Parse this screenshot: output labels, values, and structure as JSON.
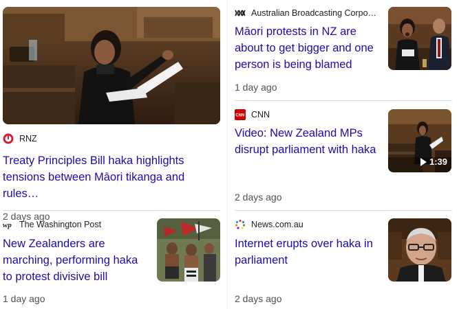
{
  "cards": [
    {
      "source": "RNZ",
      "source_icon": "rnz-logo-icon",
      "title": "Treaty Principles Bill haka highlights tensions between Māori tikanga and rules…",
      "time": "2 days ago",
      "thumb_icon": "parliament-photo"
    },
    {
      "source": "Australian Broadcasting Corpor…",
      "source_icon": "abc-logo-icon",
      "title": "Māori protests in NZ are about to get bigger and one person is being blamed",
      "time": "1 day ago",
      "thumb_icon": "parliament-photo"
    },
    {
      "source": "CNN",
      "source_icon": "cnn-logo-icon",
      "title": "Video: New Zealand MPs disrupt parliament with haka",
      "time": "2 days ago",
      "duration": "1:39",
      "thumb_icon": "video-thumbnail"
    },
    {
      "source": "The Washington Post",
      "source_icon": "wp-logo-icon",
      "title": "New Zealanders are marching, performing haka to protest divisive bill",
      "time": "1 day ago",
      "thumb_icon": "march-photo"
    },
    {
      "source": "News.com.au",
      "source_icon": "newscomau-logo-icon",
      "title": "Internet erupts over haka in parliament",
      "time": "2 days ago",
      "thumb_icon": "portrait-photo"
    }
  ],
  "colors": {
    "link": "#1a0dab",
    "meta": "#4d5156",
    "rnz": "#d3202f",
    "cnn": "#cc0000"
  }
}
